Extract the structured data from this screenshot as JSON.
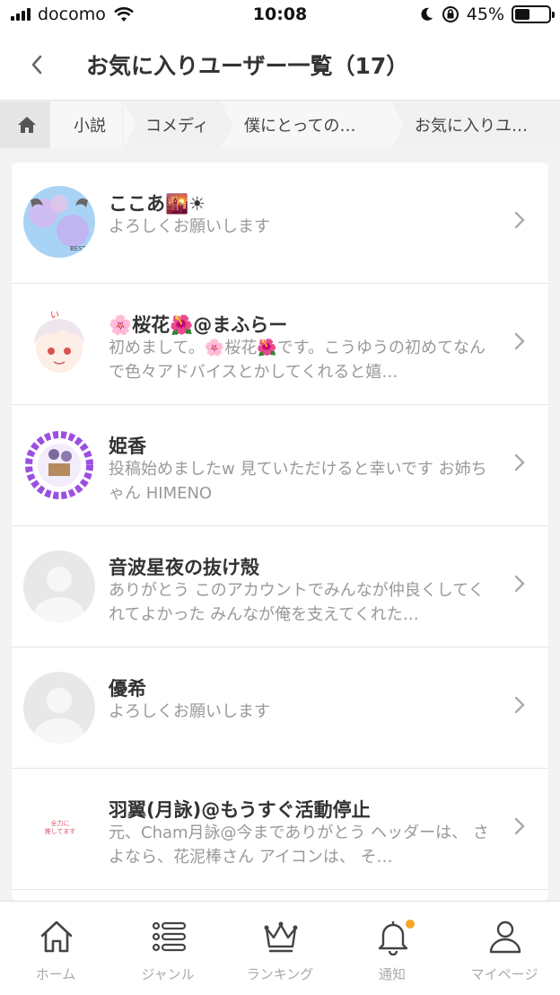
{
  "status_bar": {
    "carrier": "docomo",
    "time": "10:08",
    "battery_text": "45%",
    "battery_level": 0.45
  },
  "header": {
    "title": "お気に入りユーザー一覧（17）"
  },
  "breadcrumb": [
    "小説",
    "コメディ",
    "僕にとっての…",
    "お気に入りユ…"
  ],
  "users": [
    {
      "name": "ここあ🌇☀",
      "bio": "よろしくお願いします",
      "avatar": "pastel-pattern-avatar"
    },
    {
      "name": "🌸桜花🌺@まふらー",
      "bio": "初めまして。🌸桜花🌺です。こうゆうの初めてなんで色々アドバイスとかしてくれると嬉…",
      "avatar": "anime-character-avatar"
    },
    {
      "name": "姫香",
      "bio": "投稿始めましたw 見ていただけると幸いです お姉ちゃん HIMENO",
      "avatar": "purple-frame-avatar"
    },
    {
      "name": "音波星夜の抜け殻",
      "bio": "ありがとう このアカウントでみんなが仲良くしてくれてよかった みんなが俺を支えてくれた…",
      "avatar": "default-avatar"
    },
    {
      "name": "優希",
      "bio": "よろしくお願いします",
      "avatar": "default-avatar"
    },
    {
      "name": "羽翼(月詠)@もうすぐ活動停止",
      "bio": "元、Cham月詠@今までありがとう ヘッダーは、 さよなら、花泥棒さん アイコンは、 そ…",
      "avatar": "text-avatar",
      "avatar_text": "全力に\n推してます"
    }
  ],
  "tabs": [
    {
      "label": "ホーム",
      "icon": "home-icon"
    },
    {
      "label": "ジャンル",
      "icon": "list-icon"
    },
    {
      "label": "ランキング",
      "icon": "crown-icon"
    },
    {
      "label": "通知",
      "icon": "bell-icon",
      "badge": true
    },
    {
      "label": "マイページ",
      "icon": "person-icon"
    }
  ],
  "colors": {
    "badge": "#f5a623",
    "icon": "#444444",
    "subtext": "#999999"
  }
}
